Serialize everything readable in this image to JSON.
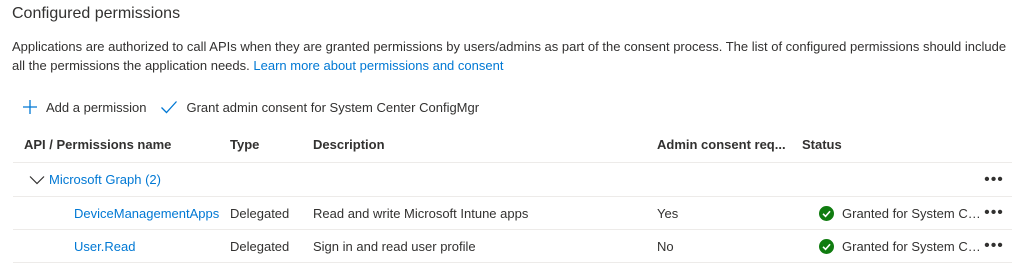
{
  "section": {
    "title": "Configured permissions",
    "description_prefix": "Applications are authorized to call APIs when they are granted permissions by users/admins as part of the consent process. The list of configured permissions should include all the permissions the application needs.",
    "learn_more_link": "Learn more about permissions and consent"
  },
  "toolbar": {
    "add_permission_label": "Add a permission",
    "grant_consent_label": "Grant admin consent for System Center ConfigMgr"
  },
  "table": {
    "headers": {
      "api": "API / Permissions name",
      "type": "Type",
      "description": "Description",
      "admin_consent": "Admin consent req...",
      "status": "Status"
    },
    "group": {
      "label": "Microsoft Graph (2)",
      "more": "•••"
    },
    "rows": [
      {
        "name": "DeviceManagementApps.R",
        "type": "Delegated",
        "description": "Read and write Microsoft Intune apps",
        "admin_consent": "Yes",
        "status": "Granted for System Cen...",
        "more": "•••"
      },
      {
        "name": "User.Read",
        "type": "Delegated",
        "description": "Sign in and read user profile",
        "admin_consent": "No",
        "status": "Granted for System Cen...",
        "more": "•••"
      }
    ]
  },
  "colors": {
    "accent": "#0078d4",
    "text": "#323130",
    "success": "#107c10",
    "divider": "#edebe9"
  },
  "icons": {
    "add": "plus-icon",
    "grant": "checkmark-icon",
    "expand": "chevron-down-icon",
    "status": "check-circle-icon",
    "more": "more-icon"
  }
}
